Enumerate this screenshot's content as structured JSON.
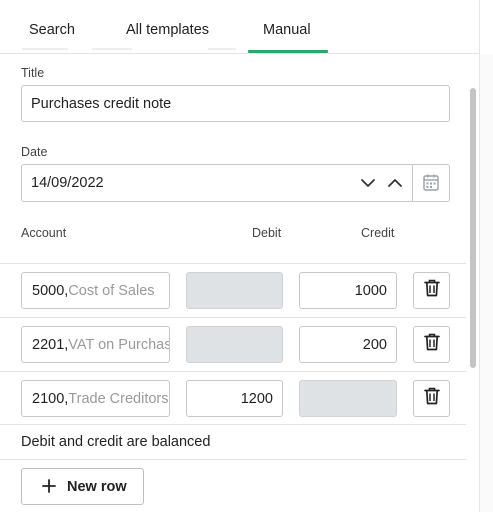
{
  "tabs": [
    {
      "label": "Search"
    },
    {
      "label": "All templates"
    },
    {
      "label": "Manual"
    }
  ],
  "form": {
    "title_label": "Title",
    "title_value": "Purchases credit note",
    "date_label": "Date",
    "date_value": "14/09/2022"
  },
  "table": {
    "headers": {
      "account": "Account",
      "debit": "Debit",
      "credit": "Credit"
    },
    "rows": [
      {
        "account_code": "5000,",
        "account_name": " Cost of Sales",
        "debit": "",
        "credit": "1000"
      },
      {
        "account_code": "2201,",
        "account_name": " VAT on Purchases",
        "debit": "",
        "credit": "200"
      },
      {
        "account_code": "2100,",
        "account_name": " Trade Creditors",
        "debit": "1200",
        "credit": ""
      }
    ]
  },
  "status": {
    "balanced_text": "Debit and credit are balanced"
  },
  "actions": {
    "new_row_label": "New row"
  },
  "icons": {
    "date_down": "chevron-down-icon",
    "date_up": "chevron-up-icon",
    "calendar": "calendar-icon",
    "delete": "trash-icon",
    "add": "plus-icon"
  },
  "colors": {
    "accent": "#2aa86a",
    "disabled_field": "#dfe2e5"
  }
}
